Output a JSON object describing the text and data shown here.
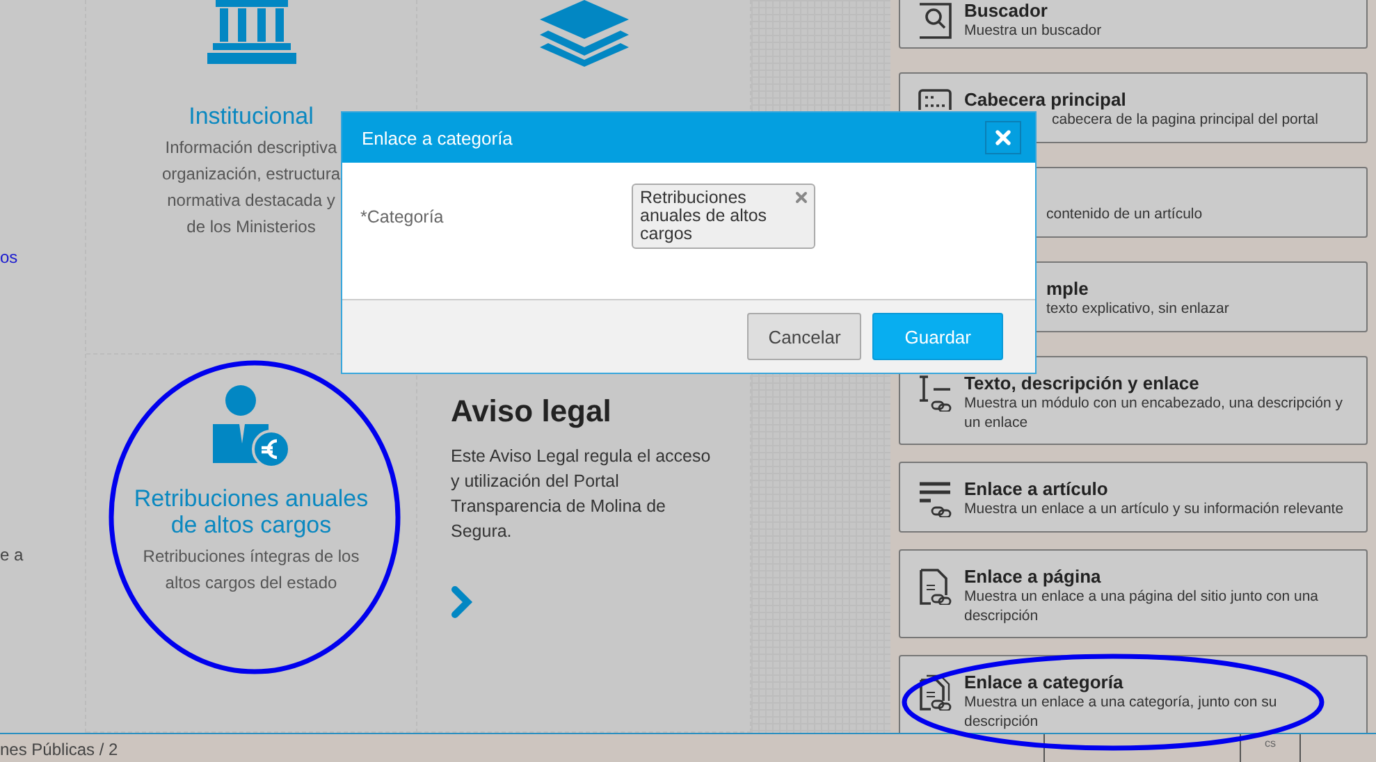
{
  "left_fragments": [
    {
      "kind": "link",
      "text": "os"
    },
    {
      "kind": "text",
      "text": "e a"
    }
  ],
  "tiles": [
    {
      "kind": "feature",
      "title": "Institucional",
      "description_lines": [
        "Información descriptiva",
        "organización, estructura",
        "normativa destacada y",
        "de los Ministerios"
      ]
    },
    {
      "kind": "feature"
    },
    {
      "kind": "feature",
      "title": "Retribuciones anuales de altos cargos",
      "description_lines": [
        "Retribuciones íntegras de los altos cargos del estado"
      ]
    },
    {
      "kind": "article",
      "title": "Aviso legal",
      "description_lines": [
        "Este Aviso Legal regula el acceso y utilización del Portal Transparencia de Molina de Segura."
      ]
    }
  ],
  "sidebar_cards": [
    {
      "title": "Buscador",
      "description": "Muestra un buscador"
    },
    {
      "title": "Cabecera principal",
      "description": "cabecera de la pagina principal del portal"
    },
    {
      "description": "contenido de un artículo"
    },
    {
      "title": "mple",
      "description": "texto explicativo, sin enlazar"
    },
    {
      "title": "Texto, descripción y enlace",
      "description": "Muestra un módulo con un encabezado, una descripción y un enlace"
    },
    {
      "title": "Enlace a artículo",
      "description": "Muestra un enlace a un artículo y su información relevante"
    },
    {
      "title": "Enlace a página",
      "description": "Muestra un enlace a una página del sitio junto con una descripción"
    },
    {
      "title": "Enlace a categoría",
      "description": "Muestra un enlace a una categoría, junto con su descripción"
    }
  ],
  "status_bar": {
    "breadcrumb": "nes Públicas /  2",
    "code": "cs"
  },
  "dialog": {
    "title": "Enlace a categoría",
    "field_label": "*Categoría",
    "chip": "Retribuciones anuales de altos cargos",
    "buttons": [
      {
        "kind": "secondary",
        "label": "Cancelar"
      },
      {
        "kind": "primary",
        "label": "Guardar"
      }
    ]
  },
  "annotations": [
    {
      "kind": "circle"
    },
    {
      "kind": "ellipse"
    }
  ]
}
